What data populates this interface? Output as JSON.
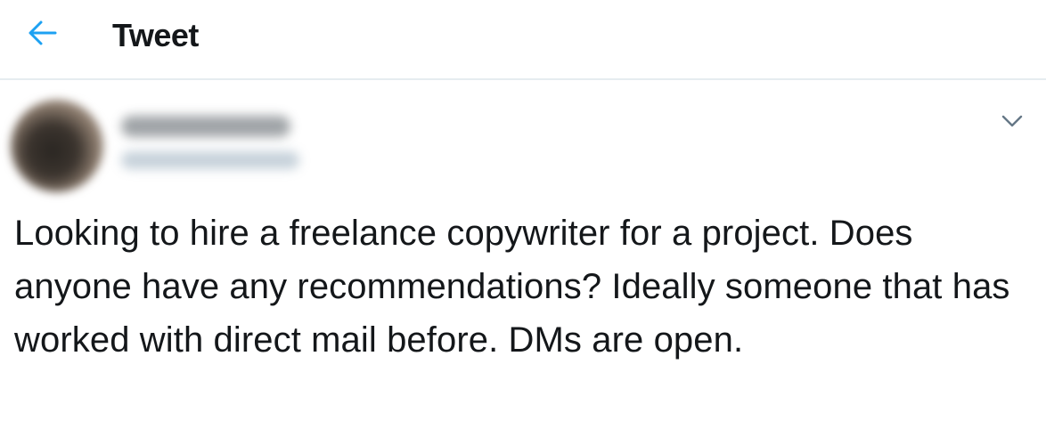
{
  "header": {
    "title": "Tweet",
    "back_icon": "arrow-left-icon",
    "accent_color": "#1da1f2"
  },
  "tweet": {
    "author": {
      "display_name": "",
      "handle": "",
      "avatar_blurred": true
    },
    "menu_icon": "chevron-down-icon",
    "text": "Looking to hire a freelance copywriter for a project. Does anyone have any recommendations? Ideally someone that has worked with direct mail before. DMs are open."
  }
}
